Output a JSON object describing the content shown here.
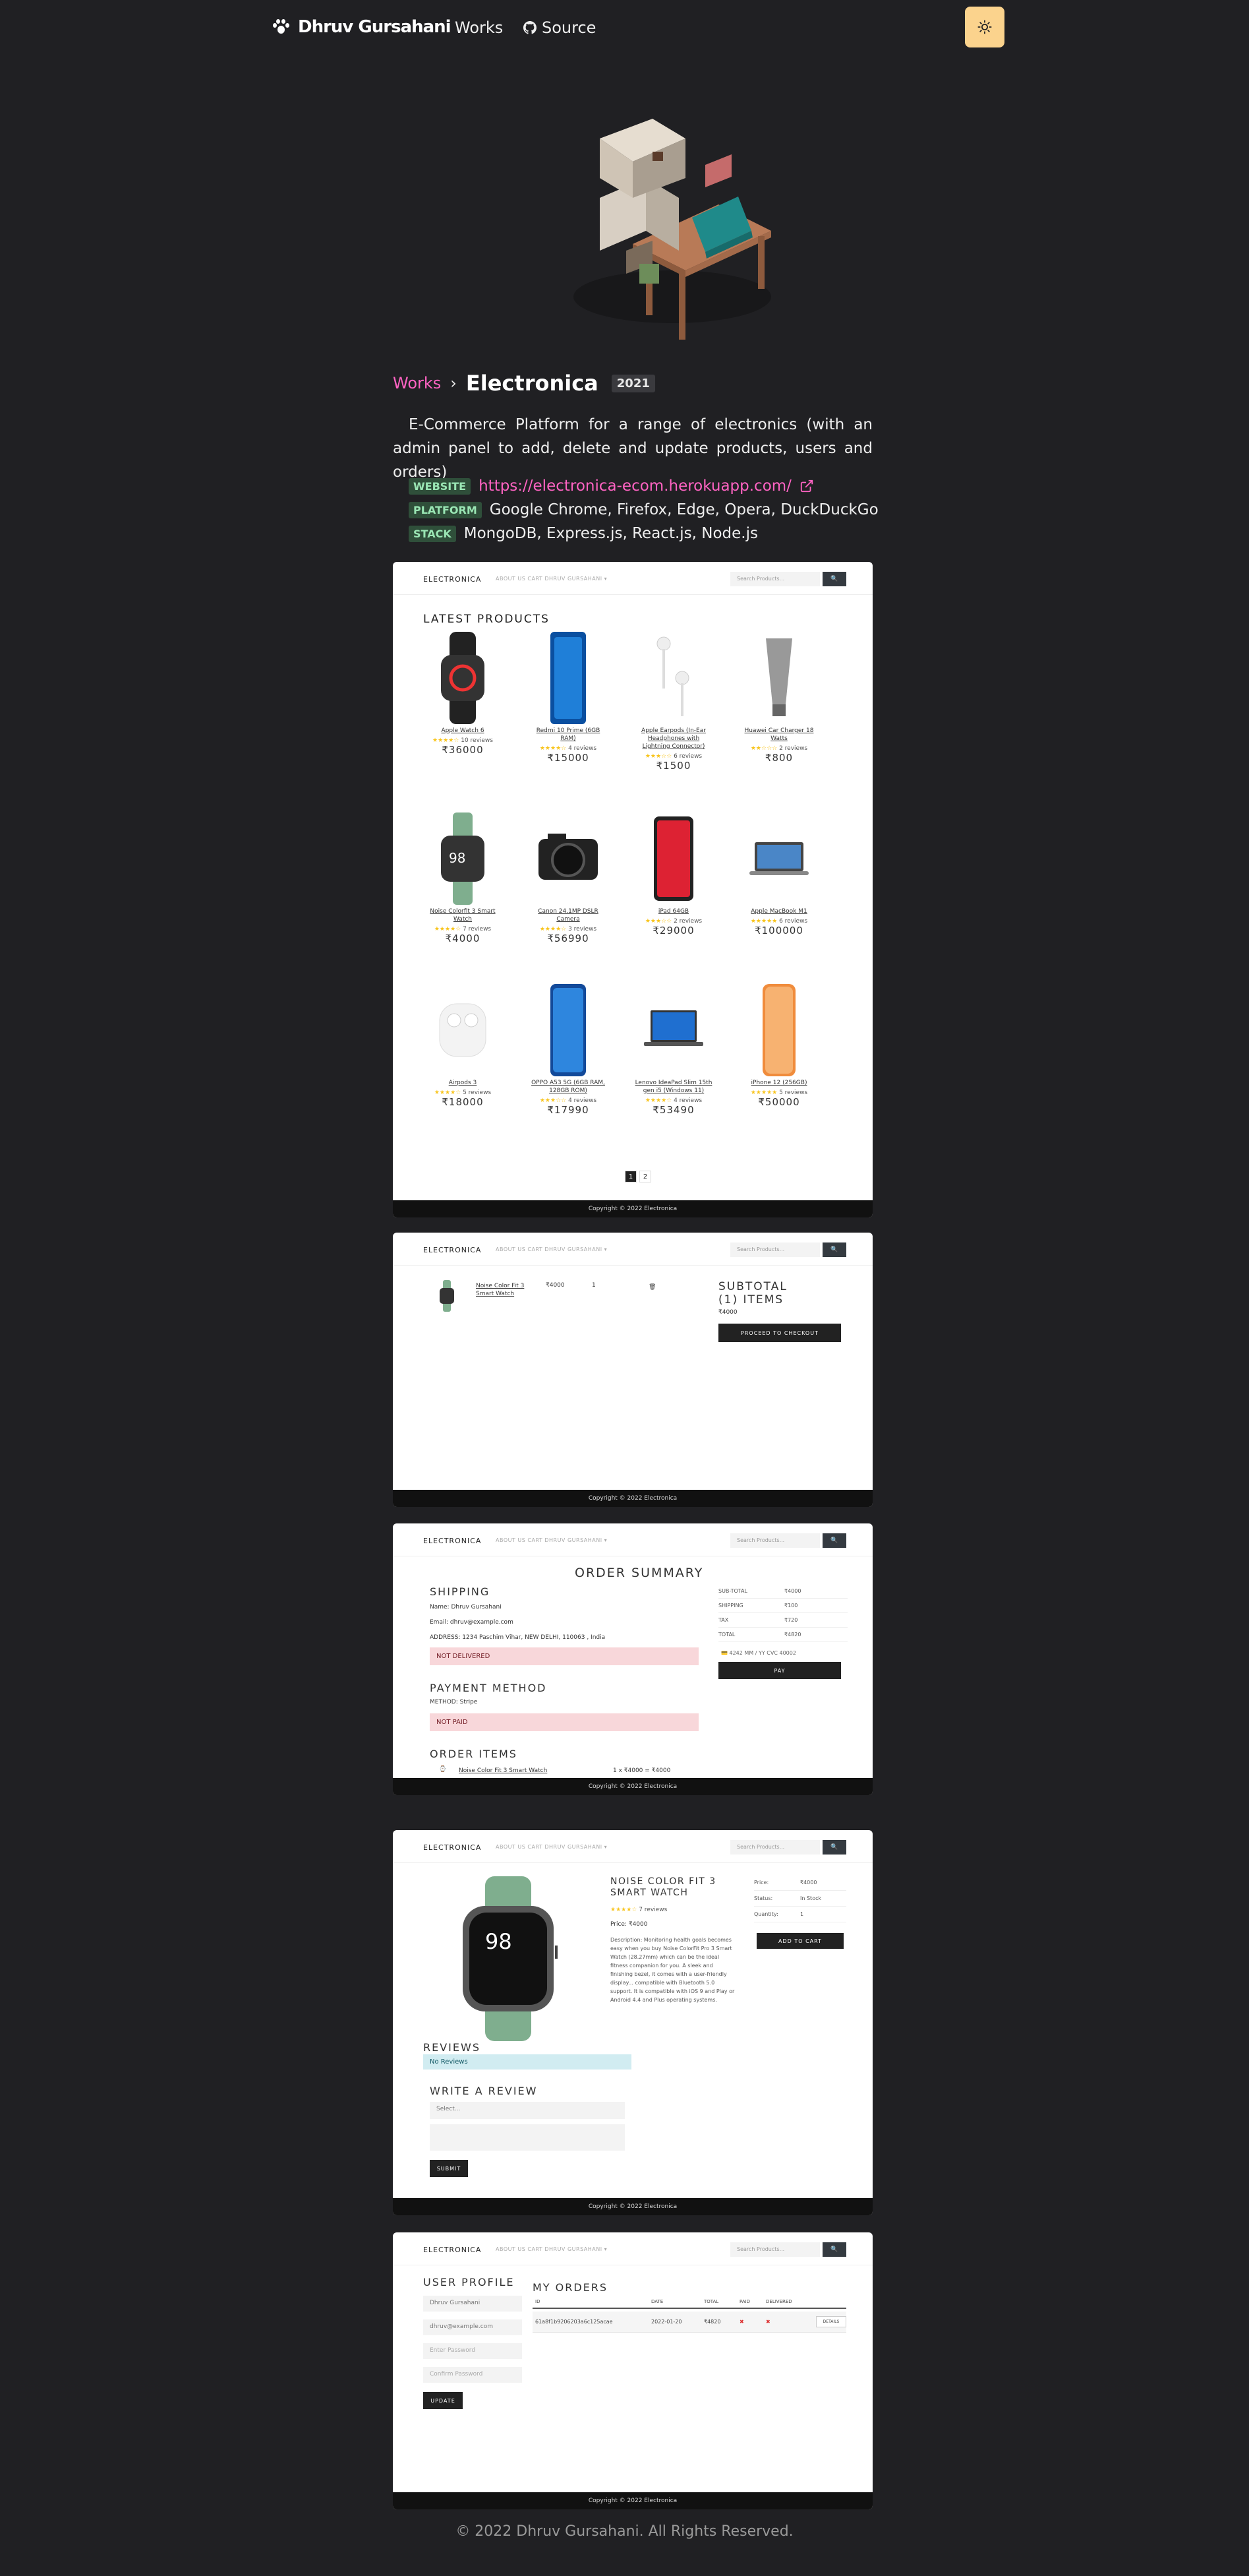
{
  "nav": {
    "brand": "Dhruv Gursahani",
    "works": "Works",
    "source": "Source"
  },
  "breadcrumb": {
    "parent": "Works",
    "separator": "›",
    "title": "Electronica",
    "year": "2021"
  },
  "description": "E-Commerce Platform for a range of electronics (with an admin panel to add, delete and update products, users and orders)",
  "meta": {
    "website_tag": "WEBSITE",
    "website": "https://electronica-ecom.herokuapp.com/",
    "platform_tag": "PLATFORM",
    "platform": "Google Chrome, Firefox, Edge, Opera, DuckDuckGo",
    "stack_tag": "STACK",
    "stack": "MongoDB, Express.js, React.js, Node.js"
  },
  "site": {
    "brand": "ELECTRONICA",
    "links": "ABOUT US   CART   DHRUV GURSAHANI ▾",
    "search_placeholder": "Search Products...",
    "copyright": "Copyright © 2022 Electronica"
  },
  "home": {
    "heading": "LATEST PRODUCTS",
    "products": [
      {
        "name": "Apple Watch 6",
        "reviews": "10 reviews",
        "price": "₹36000",
        "stars": "★★★★☆"
      },
      {
        "name": "Redmi 10 Prime (6GB RAM)",
        "reviews": "4 reviews",
        "price": "₹15000",
        "stars": "★★★★☆"
      },
      {
        "name": "Apple Earpods (In-Ear Headphones with Lightning Connector)",
        "reviews": "6 reviews",
        "price": "₹1500",
        "stars": "★★★☆☆"
      },
      {
        "name": "Huawei Car Charger 18 Watts",
        "reviews": "2 reviews",
        "price": "₹800",
        "stars": "★★☆☆☆"
      },
      {
        "name": "Noise Colorfit 3 Smart Watch",
        "reviews": "7 reviews",
        "price": "₹4000",
        "stars": "★★★★☆"
      },
      {
        "name": "Canon 24.1MP DSLR Camera",
        "reviews": "3 reviews",
        "price": "₹56990",
        "stars": "★★★★☆"
      },
      {
        "name": "iPad 64GB",
        "reviews": "2 reviews",
        "price": "₹29000",
        "stars": "★★★☆☆"
      },
      {
        "name": "Apple MacBook M1",
        "reviews": "6 reviews",
        "price": "₹100000",
        "stars": "★★★★★"
      },
      {
        "name": "Airpods 3",
        "reviews": "5 reviews",
        "price": "₹18000",
        "stars": "★★★★☆"
      },
      {
        "name": "OPPO A53 5G (6GB RAM, 128GB ROM)",
        "reviews": "4 reviews",
        "price": "₹17990",
        "stars": "★★★☆☆"
      },
      {
        "name": "Lenovo IdeaPad Slim 15th gen i5 (Windows 11)",
        "reviews": "4 reviews",
        "price": "₹53490",
        "stars": "★★★★☆"
      },
      {
        "name": "iPhone 12 (256GB)",
        "reviews": "5 reviews",
        "price": "₹50000",
        "stars": "★★★★★"
      }
    ],
    "pages": [
      "1",
      "2"
    ]
  },
  "cart": {
    "item": "Noise Color Fit 3 Smart Watch",
    "price": "₹4000",
    "qty": "1",
    "subtotal": "SUBTOTAL (1) ITEMS",
    "subtotal_value": "₹4000",
    "checkout": "PROCEED TO CHECKOUT"
  },
  "order": {
    "title": "ORDER SUMMARY",
    "shipping_h": "SHIPPING",
    "name": "Name: Dhruv Gursahani",
    "email": "Email: dhruv@example.com",
    "address": "ADDRESS: 1234 Paschim Vihar, NEW DELHI, 110063 , India",
    "not_delivered": "NOT DELIVERED",
    "payment_h": "PAYMENT METHOD",
    "method": "METHOD: Stripe",
    "not_paid": "NOT PAID",
    "items_h": "ORDER ITEMS",
    "item": "Noise Color Fit 3 Smart Watch",
    "item_calc": "1 x ₹4000 = ₹4000",
    "summary": [
      {
        "label": "SUB-TOTAL",
        "value": "₹4000"
      },
      {
        "label": "SHIPPING",
        "value": "₹100"
      },
      {
        "label": "TAX",
        "value": "₹720"
      },
      {
        "label": "TOTAL",
        "value": "₹4820"
      }
    ],
    "card": "💳 4242   MM / YY   CVC   40002",
    "pay": "PAY"
  },
  "product": {
    "title": "NOISE COLOR FIT 3 SMART WATCH",
    "stars": "★★★★☆",
    "reviews": "7 reviews",
    "price_line": "Price: ₹4000",
    "description": "Description: Monitoring health goals becomes easy when you buy Noise ColorFit Pro 3 Smart Watch (28.27mm) which can be the ideal fitness companion for you. A sleek and finishing bezel, it comes with a user-friendly display... compatible with Bluetooth 5.0 support. It is compatible with iOS 9 and Play or Android 4.4 and Plus operating systems.",
    "watch_value": "98",
    "price_label": "Price:",
    "price": "₹4000",
    "status_label": "Status:",
    "status": "In Stock",
    "qty_label": "Quantity:",
    "qty": "1",
    "add": "ADD TO CART",
    "reviews_h": "REVIEWS",
    "no_reviews": "No Reviews",
    "write_h": "WRITE A REVIEW",
    "select": "Select...",
    "submit": "SUBMIT"
  },
  "profile": {
    "heading": "USER PROFILE",
    "name": "Dhruv Gursahani",
    "email": "dhruv@example.com",
    "password": "Enter Password",
    "confirm": "Confirm Password",
    "update": "UPDATE",
    "orders_h": "MY ORDERS",
    "cols": [
      "ID",
      "DATE",
      "TOTAL",
      "PAID",
      "DELIVERED",
      ""
    ],
    "row": [
      "61a8f1b9206203a6c125acae",
      "2022-01-20",
      "₹4820",
      "✖",
      "✖",
      "DETAILS"
    ]
  },
  "footer": "© 2022 Dhruv Gursahani. All Rights Reserved.",
  "colors": {
    "bg": "#202023",
    "accent": "#ff63c3",
    "theme_button": "#fbd38d",
    "tag_bg": "#2f4f3a",
    "tag_text": "#9ae6b4"
  }
}
